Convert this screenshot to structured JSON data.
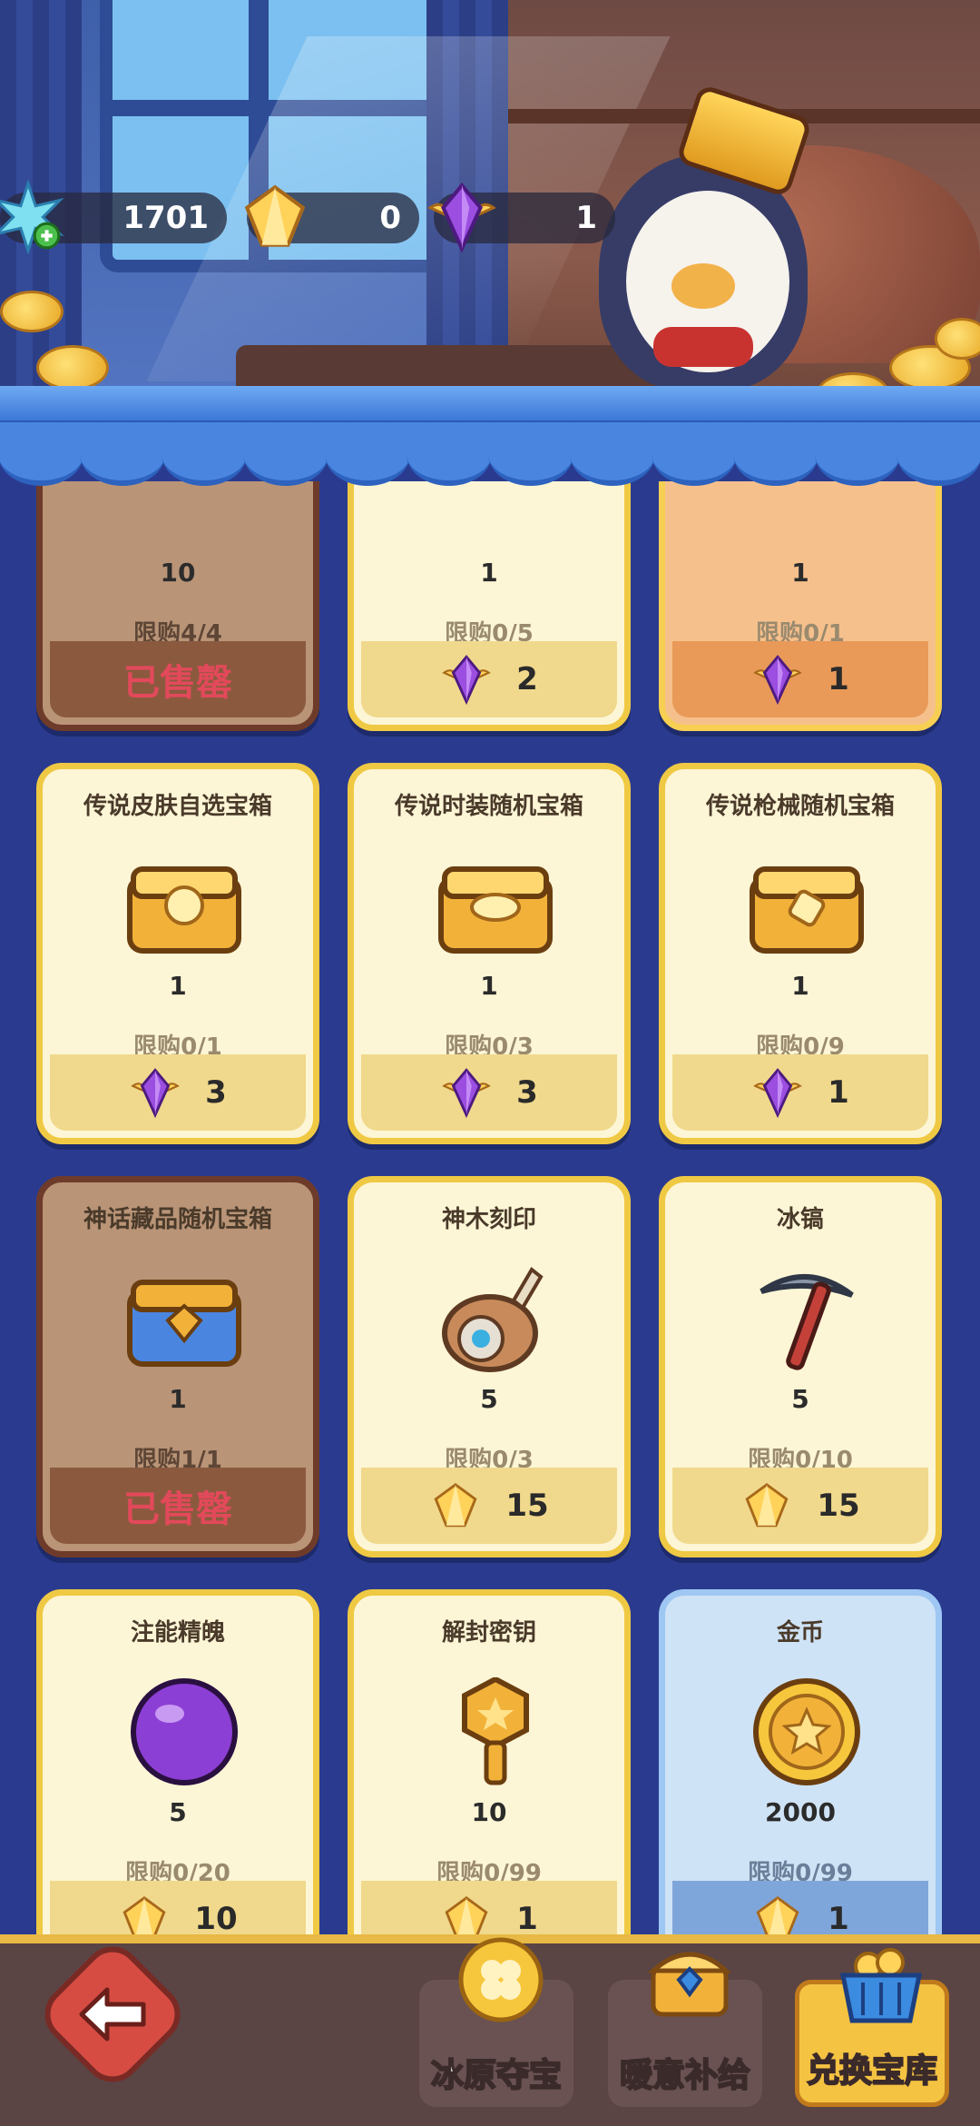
{
  "currency": {
    "snowflake": "1701",
    "gold_crystal": "0",
    "purple_gem": "1"
  },
  "cards": [
    {
      "title": "",
      "qty": "10",
      "limit": "限购4/4",
      "price": "",
      "status": "已售罄",
      "cost_icon": "",
      "theme": "soldout"
    },
    {
      "title": "",
      "qty": "1",
      "limit": "限购0/5",
      "price": "2",
      "status": "",
      "cost_icon": "purple-gem-icon",
      "theme": "normal"
    },
    {
      "title": "",
      "qty": "1",
      "limit": "限购0/1",
      "price": "1",
      "status": "",
      "cost_icon": "purple-gem-icon",
      "theme": "orange"
    },
    {
      "title": "传说皮肤自选宝箱",
      "qty": "1",
      "limit": "限购0/1",
      "price": "3",
      "status": "",
      "cost_icon": "purple-gem-icon",
      "theme": "normal"
    },
    {
      "title": "传说时装随机宝箱",
      "qty": "1",
      "limit": "限购0/3",
      "price": "3",
      "status": "",
      "cost_icon": "purple-gem-icon",
      "theme": "normal"
    },
    {
      "title": "传说枪械随机宝箱",
      "qty": "1",
      "limit": "限购0/9",
      "price": "1",
      "status": "",
      "cost_icon": "purple-gem-icon",
      "theme": "normal"
    },
    {
      "title": "神话藏品随机宝箱",
      "qty": "1",
      "limit": "限购1/1",
      "price": "",
      "status": "已售罄",
      "cost_icon": "",
      "theme": "soldout"
    },
    {
      "title": "神木刻印",
      "qty": "5",
      "limit": "限购0/3",
      "price": "15",
      "status": "",
      "cost_icon": "gold-crystal-icon",
      "theme": "normal"
    },
    {
      "title": "冰镐",
      "qty": "5",
      "limit": "限购0/10",
      "price": "15",
      "status": "",
      "cost_icon": "gold-crystal-icon",
      "theme": "normal"
    },
    {
      "title": "注能精魄",
      "qty": "5",
      "limit": "限购0/20",
      "price": "10",
      "status": "",
      "cost_icon": "gold-crystal-icon",
      "theme": "normal"
    },
    {
      "title": "解封密钥",
      "qty": "10",
      "limit": "限购0/99",
      "price": "1",
      "status": "",
      "cost_icon": "gold-crystal-icon",
      "theme": "normal"
    },
    {
      "title": "金币",
      "qty": "2000",
      "limit": "限购0/99",
      "price": "1",
      "status": "",
      "cost_icon": "gold-crystal-icon",
      "theme": "blue"
    }
  ],
  "nav": {
    "tab1": "冰原夺宝",
    "tab2": "暖意补给",
    "tab3": "兑换宝库"
  },
  "colors": {
    "background": "#2a3b8f",
    "card_gold": "#f0c944",
    "sold_out_text": "#e2495a",
    "awning_blue": "#4a86e0"
  }
}
